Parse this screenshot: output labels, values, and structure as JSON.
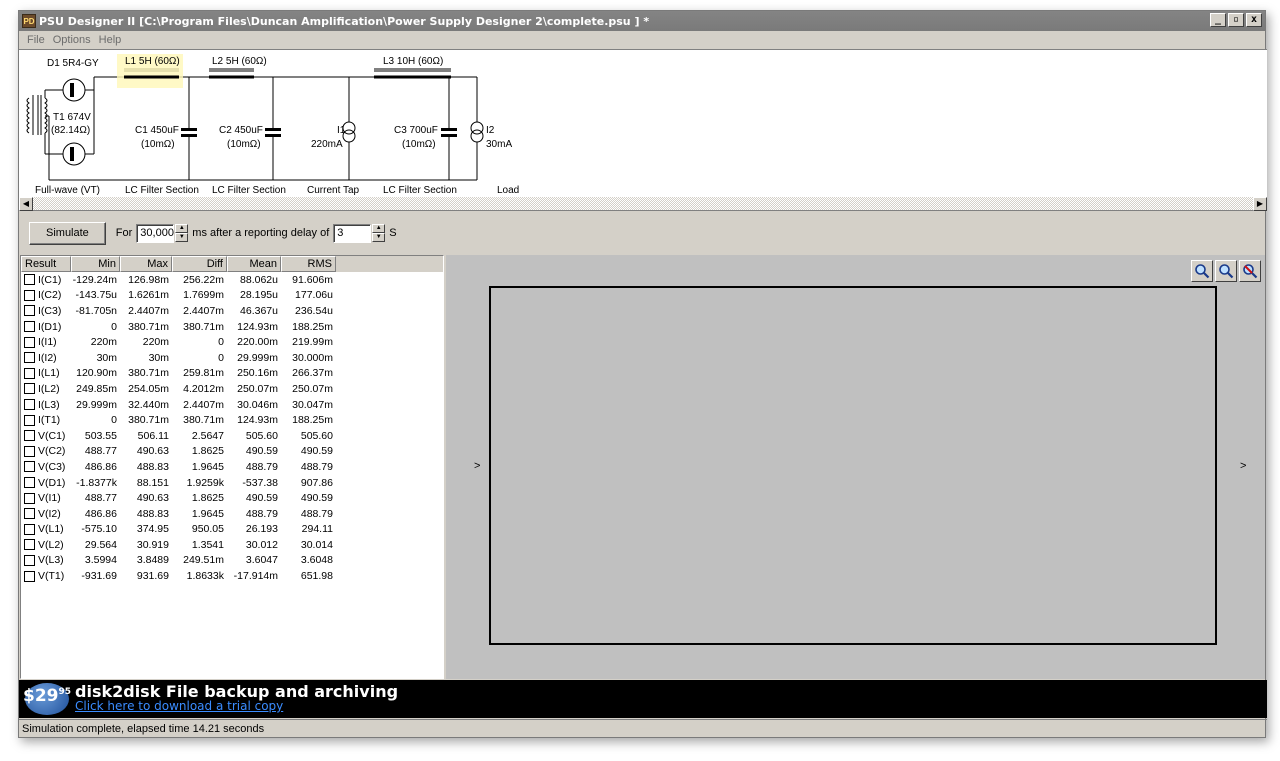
{
  "window": {
    "title": "PSU Designer II  [C:\\Program Files\\Duncan Amplification\\Power Supply Designer 2\\complete.psu ] *",
    "icon_label": "PD",
    "controls": {
      "minimize": "_",
      "maximize": "▫",
      "close": "x"
    }
  },
  "menu": [
    "File",
    "Options",
    "Help"
  ],
  "schematic": {
    "rectifier": "D1 5R4-GY",
    "transformer": "T1 674V",
    "transformer_res": "(82.14Ω)",
    "l1": "L1 5H (60Ω)",
    "l2": "L2 5H (60Ω)",
    "l3": "L3 10H (60Ω)",
    "c1": "C1 450uF",
    "c1_esr": "(10mΩ)",
    "c2": "C2 450uF",
    "c2_esr": "(10mΩ)",
    "c3": "C3 700uF",
    "c3_esr": "(10mΩ)",
    "i1": "I1",
    "i1_val": "220mA",
    "i2": "I2",
    "i2_val": "30mA",
    "sections": [
      "Full-wave (VT)",
      "LC Filter Section",
      "LC Filter Section",
      "Current Tap",
      "LC Filter Section",
      "Load"
    ]
  },
  "controls": {
    "simulate_label": "Simulate",
    "for_label": "For",
    "duration_value": "30,000",
    "ms_label": "ms  after a reporting delay of",
    "delay_value": "3",
    "s_label": "S"
  },
  "results": {
    "columns": [
      "Result",
      "Min",
      "Max",
      "Diff",
      "Mean",
      "RMS"
    ],
    "rows": [
      [
        "I(C1)",
        "-129.24m",
        "126.98m",
        "256.22m",
        "88.062u",
        "91.606m"
      ],
      [
        "I(C2)",
        "-143.75u",
        "1.6261m",
        "1.7699m",
        "28.195u",
        "177.06u"
      ],
      [
        "I(C3)",
        "-81.705n",
        "2.4407m",
        "2.4407m",
        "46.367u",
        "236.54u"
      ],
      [
        "I(D1)",
        "0",
        "380.71m",
        "380.71m",
        "124.93m",
        "188.25m"
      ],
      [
        "I(I1)",
        "220m",
        "220m",
        "0",
        "220.00m",
        "219.99m"
      ],
      [
        "I(I2)",
        "30m",
        "30m",
        "0",
        "29.999m",
        "30.000m"
      ],
      [
        "I(L1)",
        "120.90m",
        "380.71m",
        "259.81m",
        "250.16m",
        "266.37m"
      ],
      [
        "I(L2)",
        "249.85m",
        "254.05m",
        "4.2012m",
        "250.07m",
        "250.07m"
      ],
      [
        "I(L3)",
        "29.999m",
        "32.440m",
        "2.4407m",
        "30.046m",
        "30.047m"
      ],
      [
        "I(T1)",
        "0",
        "380.71m",
        "380.71m",
        "124.93m",
        "188.25m"
      ],
      [
        "V(C1)",
        "503.55",
        "506.11",
        "2.5647",
        "505.60",
        "505.60"
      ],
      [
        "V(C2)",
        "488.77",
        "490.63",
        "1.8625",
        "490.59",
        "490.59"
      ],
      [
        "V(C3)",
        "486.86",
        "488.83",
        "1.9645",
        "488.79",
        "488.79"
      ],
      [
        "V(D1)",
        "-1.8377k",
        "88.151",
        "1.9259k",
        "-537.38",
        "907.86"
      ],
      [
        "V(I1)",
        "488.77",
        "490.63",
        "1.8625",
        "490.59",
        "490.59"
      ],
      [
        "V(I2)",
        "486.86",
        "488.83",
        "1.9645",
        "488.79",
        "488.79"
      ],
      [
        "V(L1)",
        "-575.10",
        "374.95",
        "950.05",
        "26.193",
        "294.11"
      ],
      [
        "V(L2)",
        "29.564",
        "30.919",
        "1.3541",
        "30.012",
        "30.014"
      ],
      [
        "V(L3)",
        "3.5994",
        "3.8489",
        "249.51m",
        "3.6047",
        "3.6048"
      ],
      [
        "V(T1)",
        "-931.69",
        "931.69",
        "1.8633k",
        "-17.914m",
        "651.98"
      ]
    ]
  },
  "graph": {
    "left_arrow": ">",
    "right_arrow": ">",
    "zoom_buttons": [
      "zoom-in-icon",
      "zoom-out-icon",
      "zoom-reset-icon"
    ]
  },
  "banner": {
    "price": "$29",
    "price_cents": "95",
    "title": "disk2disk File backup and archiving",
    "link": "Click here to download a trial copy"
  },
  "status": "Simulation complete, elapsed time 14.21 seconds"
}
